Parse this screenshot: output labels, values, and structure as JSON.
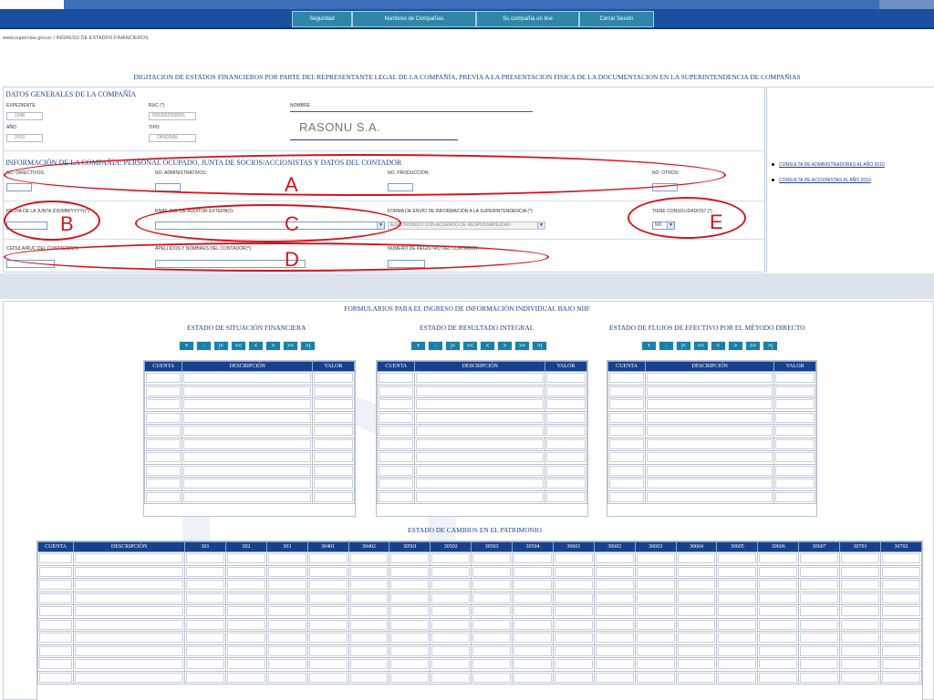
{
  "nav": {
    "items": [
      "Seguridad",
      "Nombres de Compañías",
      "Su compañía on line",
      "Cerrar Sesión"
    ]
  },
  "breadcrumb": "www.supercias.gov.ec / INGRESO DE ESTADOS FINANCIEROS",
  "main_title": "DIGITACION DE ESTADOS FINANCIEROS POR PARTE DEL REPRESENTANTE LEGAL DE LA COMPAÑÍA, PREVIA A LA PRESENTACION FISICA DE LA DOCUMENTACION EN LA SUPERINTENDENCIA DE COMPAÑIAS",
  "general": {
    "title": "DATOS GENERALES DE LA COMPAÑÍA",
    "expediente_label": "EXPEDIENTE",
    "expediente_value": "1048",
    "ruc_label": "RUC (*)",
    "ruc_value": "0992652558001",
    "nombre_label": "NOMBRE",
    "nombre_value": "RASONU S.A.",
    "anio_label": "AÑO",
    "anio_value": "2010",
    "tipo_label": "TIPO",
    "tipo_value": "ORIGINAL"
  },
  "info": {
    "title": "INFORMACIÓN DE LA COMPAÑÍA: PERSONAL OCUPADO, JUNTA DE SOCIOS/ACCIONISTAS Y DATOS DEL CONTADOR",
    "directivos_label": "No. DIRECTIVOS:",
    "administrativos_label": "No. ADMINISTRATIVOS:",
    "produccion_label": "No. PRODUCCIÓN:",
    "otros_label": "No. OTROS:",
    "fecha_junta_label": "FECHA DE LA JUNTA (dd/mm/yyyy)(*):",
    "rnae_label": "RNAE (No. DE AUDITOR EXTERNO):",
    "forma_envio_label": "FORMA DE ENVÍO DE INFORMACIÓN A LA SUPERINTENDENCIA (*):",
    "forma_envio_value": "ELECTRÓNICO CON ACUERDO DE RESPONSABILIDAD",
    "consolidados_label": "TIENE CONSOLIDADOS? (*)",
    "consolidados_value": "NO",
    "cedula_label": "CEDULA/RUC DEL CONTADOR(*):",
    "apellidos_label": "APELLIDOS Y NOMBRES DEL CONTADOR(*):",
    "registro_label": "NUMERO DE REGISTRO DEL CONTADOR:"
  },
  "right_links": [
    "CONSULTA DE ADMINISTRADORES AL AÑO 2010",
    "CONSULTA DE ACCIONISTAS AL AÑO 2010"
  ],
  "annotations": [
    "A",
    "B",
    "C",
    "D",
    "E"
  ],
  "forms_title": "FORMULARIOS PARA EL INGRESO DE INFORMACIÓN INDIVIDUAL BAJO NIIF",
  "statements": [
    {
      "title": "ESTADO DE SITUACIÓN FINANCIERA"
    },
    {
      "title": "ESTADO DE RESULTADO INTEGRAL"
    },
    {
      "title": "ESTADO DE FLUJOS DE EFECTIVO POR EL MÉTODO DIRECTO"
    }
  ],
  "pager_buttons": [
    "+",
    "-",
    "|<",
    "<<",
    "<",
    ">",
    ">>",
    ">|"
  ],
  "small_table_headers": [
    "CUENTA",
    "DESCRIPCIÓN",
    "VALOR"
  ],
  "patrimonio": {
    "title": "ESTADO DE CAMBIOS EN EL PATRIMONIO",
    "headers": [
      "CUENTA",
      "DESCRIPCIÓN",
      "301",
      "302",
      "303",
      "30401",
      "30402",
      "30501",
      "30502",
      "30503",
      "30504",
      "30601",
      "30602",
      "30603",
      "30604",
      "30605",
      "30606",
      "30607",
      "30701",
      "30702"
    ]
  },
  "colors": {
    "nav_bg": "#1a4f9e",
    "nav_button": "#2e86a8",
    "table_header": "#17418c",
    "annotation": "#d4141c",
    "title_text": "#1f3f8f"
  }
}
